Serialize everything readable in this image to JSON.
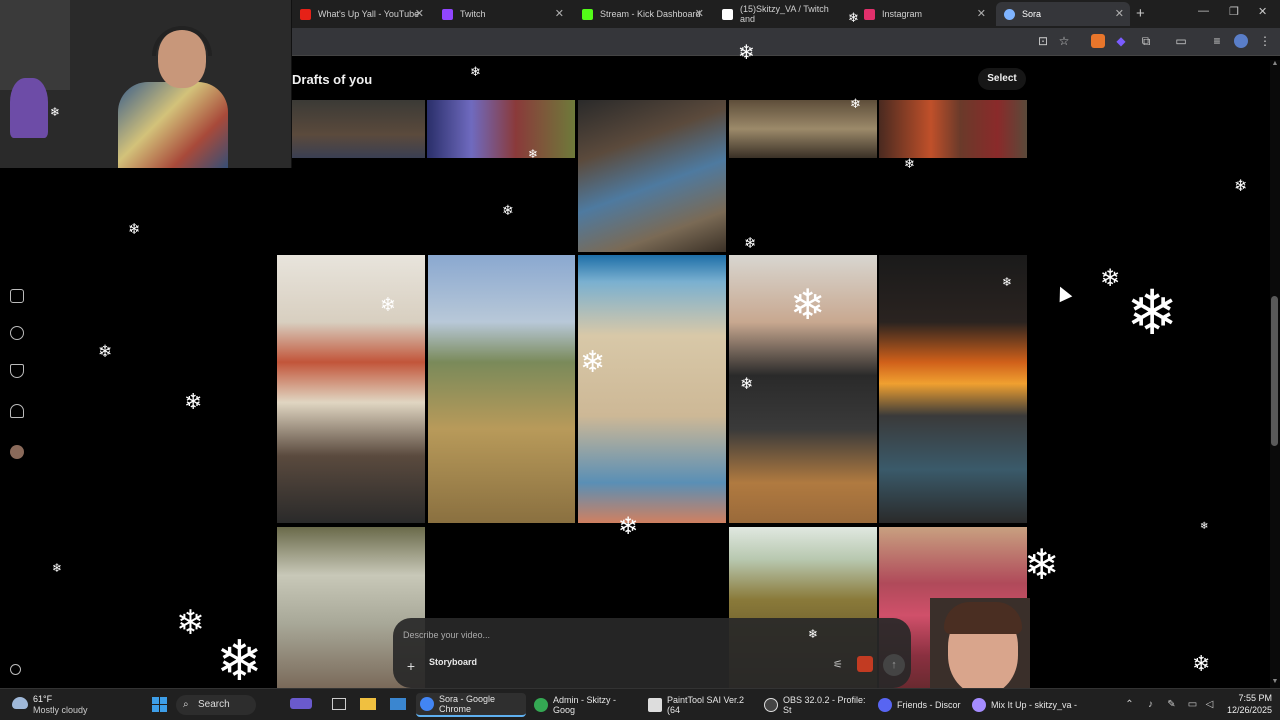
{
  "browser": {
    "tabs": [
      {
        "title": "What's Up Yall - YouTube",
        "icon": "youtube-icon",
        "color": "#e62117"
      },
      {
        "title": "Twitch",
        "icon": "twitch-icon",
        "color": "#9146ff"
      },
      {
        "title": "Stream - Kick Dashboard",
        "icon": "kick-icon",
        "color": "#53fc18"
      },
      {
        "title": "(15)Skitzy_VA / Twitch and",
        "icon": "tiktok-icon",
        "color": "#ffffff"
      },
      {
        "title": "Instagram",
        "icon": "instagram-icon",
        "color": "#e1306c"
      },
      {
        "title": "Sora",
        "icon": "sora-icon",
        "color": "#7fb4ff"
      }
    ],
    "active_tab_index": 5
  },
  "page": {
    "section_title": "Drafts of you",
    "select_label": "Select"
  },
  "composer": {
    "placeholder": "Describe your video...",
    "storyboard_label": "Storyboard"
  },
  "taskbar": {
    "weather_temp": "61°F",
    "weather_condition": "Mostly cloudy",
    "search_label": "Search",
    "apps": [
      {
        "label": "Sora - Google Chrome",
        "active": true,
        "color": "#4285f4"
      },
      {
        "label": "Admin - Skitzy - Goog",
        "active": false,
        "color": "#34a853"
      },
      {
        "label": "PaintTool SAI Ver.2 (64",
        "active": false,
        "color": "#dddddd"
      },
      {
        "label": "OBS 32.0.2 - Profile: St",
        "active": false,
        "color": "#444444"
      },
      {
        "label": "Friends - Discor",
        "active": false,
        "color": "#5865f2"
      },
      {
        "label": "Mix It Up - skitzy_va - ",
        "active": false,
        "color": "#a58cff"
      }
    ],
    "time": "7:55 PM",
    "date": "12/26/2025"
  },
  "colors": {
    "page_bg": "#000000",
    "tab_bg": "#1f1f1f",
    "toolbar_bg": "#35363a",
    "accent": "#3d9ee8"
  }
}
